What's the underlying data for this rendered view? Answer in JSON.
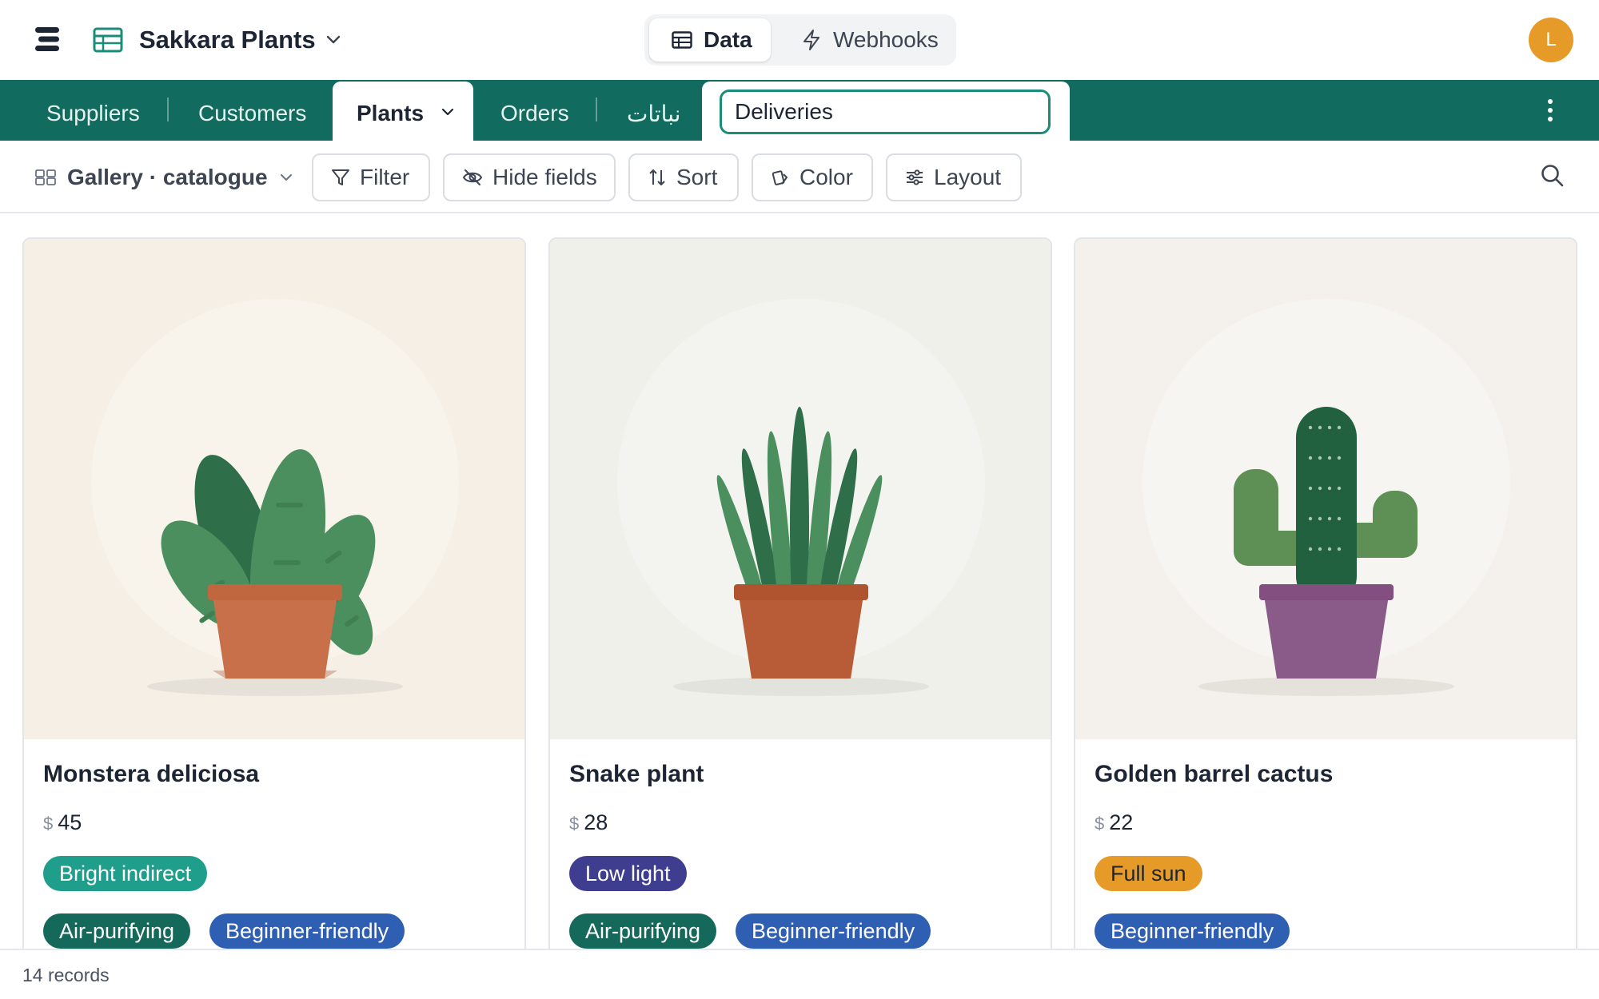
{
  "header": {
    "base_title": "Sakkara Plants",
    "modes": {
      "data": "Data",
      "webhooks": "Webhooks"
    },
    "avatar_initial": "L"
  },
  "tables": {
    "items": [
      "Suppliers",
      "Customers",
      "Plants",
      "Orders",
      "نباتات"
    ],
    "active": "Plants",
    "rename_value": "Deliveries"
  },
  "toolbar": {
    "view_name": "Gallery · catalogue",
    "filter": "Filter",
    "hide_fields": "Hide fields",
    "sort": "Sort",
    "color": "Color",
    "layout": "Layout"
  },
  "cards": [
    {
      "name": "Monstera deliciosa",
      "currency": "$",
      "price": "45",
      "light": "Bright indirect",
      "tags": [
        "Air-purifying",
        "Beginner-friendly"
      ]
    },
    {
      "name": "Snake plant",
      "currency": "$",
      "price": "28",
      "light": "Low light",
      "tags": [
        "Air-purifying",
        "Beginner-friendly"
      ]
    },
    {
      "name": "Golden barrel cactus",
      "currency": "$",
      "price": "22",
      "light": "Full sun",
      "tags": [
        "Beginner-friendly"
      ]
    }
  ],
  "footer": {
    "record_count": "14 records"
  },
  "colors": {
    "brand_green": "#116b5e",
    "tag_bright_indirect": "#1f9e8c",
    "tag_low_light": "#3f3d8f",
    "tag_full_sun": "#e69a28",
    "tag_air_purifying": "#14695a",
    "tag_beginner_friendly": "#2f5fb3",
    "avatar": "#e69a28"
  }
}
